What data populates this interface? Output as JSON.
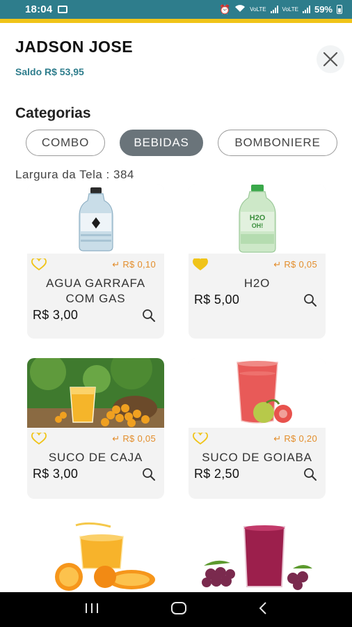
{
  "status_bar": {
    "time": "18:04",
    "network_label_1": "VoLTE",
    "network_label_2": "VoLTE",
    "battery": "59%"
  },
  "header": {
    "user_name": "JADSON JOSE",
    "balance": "Saldo R$ 53,95"
  },
  "categories": {
    "title": "Categorias",
    "items": [
      {
        "label": "COMBO",
        "active": false
      },
      {
        "label": "BEBIDAS",
        "active": true
      },
      {
        "label": "BOMBONIERE",
        "active": false
      }
    ]
  },
  "debug": {
    "screen_width": "Largura da Tela : 384"
  },
  "products": [
    {
      "name": "AGUA GARRAFA COM GAS",
      "cashback": "R$ 0,10",
      "price": "R$ 3,00",
      "favorite": false,
      "image": "water-bottle"
    },
    {
      "name": "H2O",
      "cashback": "R$ 0,05",
      "price": "R$ 5,00",
      "favorite": true,
      "image": "h2o-bottle"
    },
    {
      "name": "SUCO DE CAJA",
      "cashback": "R$ 0,05",
      "price": "R$ 3,00",
      "favorite": false,
      "image": "caja-juice"
    },
    {
      "name": "SUCO DE GOIABA",
      "cashback": "R$ 0,20",
      "price": "R$ 2,50",
      "favorite": false,
      "image": "guava-juice"
    },
    {
      "name": "",
      "cashback": "",
      "price": "",
      "favorite": false,
      "image": "orange-juice"
    },
    {
      "name": "",
      "cashback": "",
      "price": "",
      "favorite": false,
      "image": "grape-juice"
    }
  ],
  "colors": {
    "brand": "#2e7d8c",
    "accent": "#f0c419",
    "cashback": "#e38d2b",
    "chip_active": "#6a747a"
  },
  "icons": {
    "favorite": "heart-icon",
    "cashback": "return-arrow-icon",
    "details": "search-icon",
    "close": "close-icon"
  }
}
